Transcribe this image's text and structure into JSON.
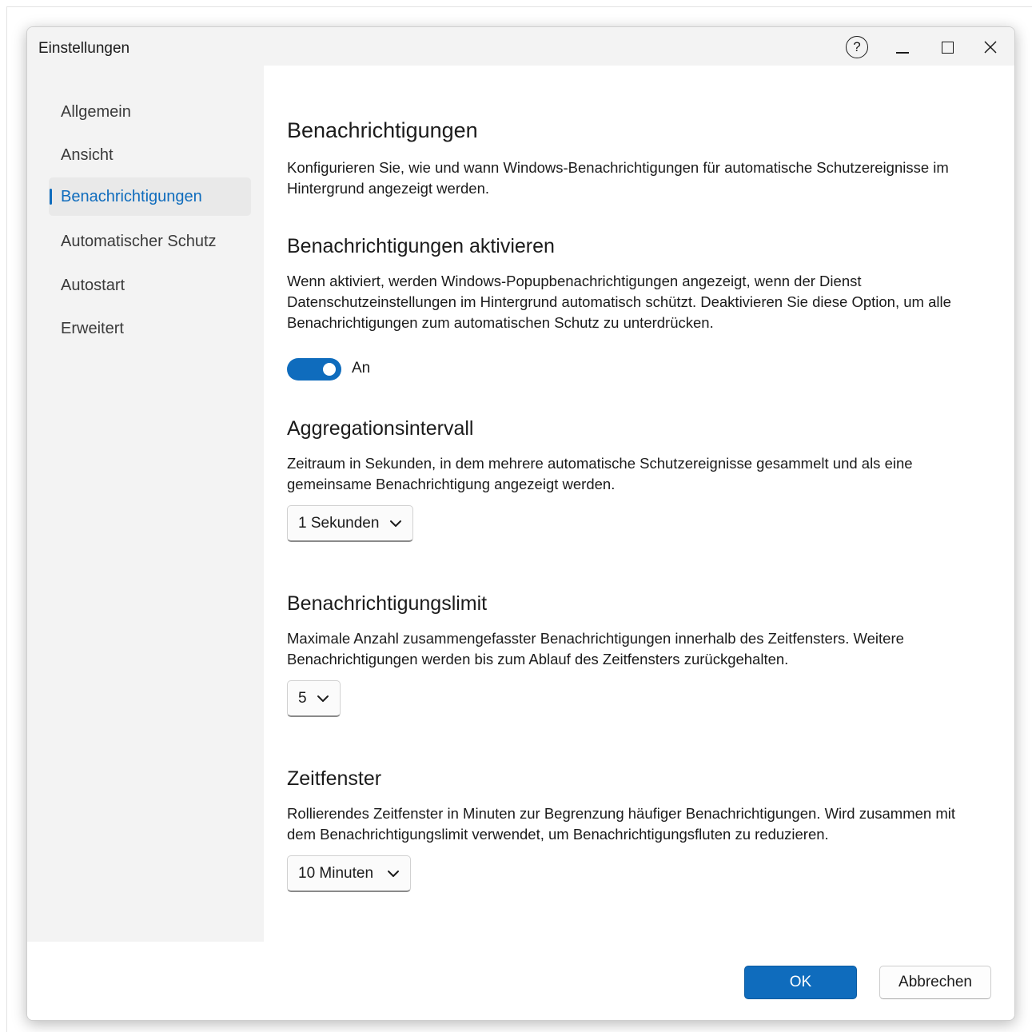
{
  "window": {
    "title": "Einstellungen",
    "help_glyph": "?",
    "icons": [
      "help-icon",
      "minimize-icon",
      "maximize-icon",
      "close-icon"
    ]
  },
  "sidebar": {
    "items": [
      {
        "label": "Allgemein",
        "active": false
      },
      {
        "label": "Ansicht",
        "active": false
      },
      {
        "label": "Benachrichtigungen",
        "active": true
      },
      {
        "label": "Automatischer Schutz",
        "active": false
      },
      {
        "label": "Autostart",
        "active": false
      },
      {
        "label": "Erweitert",
        "active": false
      }
    ]
  },
  "page": {
    "title": "Benachrichtigungen",
    "description": "Konfigurieren Sie, wie und wann Windows-Benachrichtigungen für automatische Schutzereignisse im Hintergrund angezeigt werden."
  },
  "sections": {
    "enable": {
      "title": "Benachrichtigungen aktivieren",
      "description": "Wenn aktiviert, werden Windows-Popupbenachrichtigungen angezeigt, wenn der Dienst Datenschutzeinstellungen im Hintergrund automatisch schützt. Deaktivieren Sie diese Option, um alle Benachrichtigungen zum automatischen Schutz zu unterdrücken.",
      "toggle_on": true,
      "toggle_label": "An"
    },
    "aggregation": {
      "title": "Aggregationsintervall",
      "description": "Zeitraum in Sekunden, in dem mehrere automatische Schutzereignisse gesammelt und als eine gemeinsame Benachrichtigung angezeigt werden.",
      "selected": "1 Sekunden"
    },
    "limit": {
      "title": "Benachrichtigungslimit",
      "description": "Maximale Anzahl zusammengefasster Benachrichtigungen innerhalb des Zeitfensters. Weitere Benachrichtigungen werden bis zum Ablauf des Zeitfensters zurückgehalten.",
      "selected": "5"
    },
    "window": {
      "title": "Zeitfenster",
      "description": "Rollierendes Zeitfenster in Minuten zur Begrenzung häufiger Benachrichtigungen. Wird zusammen mit dem Benachrichtigungslimit verwendet, um Benachrichtigungsfluten zu reduzieren.",
      "selected": "10 Minuten"
    }
  },
  "footer": {
    "ok_label": "OK",
    "cancel_label": "Abbrechen"
  },
  "colors": {
    "accent": "#0f6cbd",
    "sidebar_bg": "#f3f3f3",
    "selected_item_bg": "#e9e9e9",
    "text": "#1b1b1b"
  }
}
